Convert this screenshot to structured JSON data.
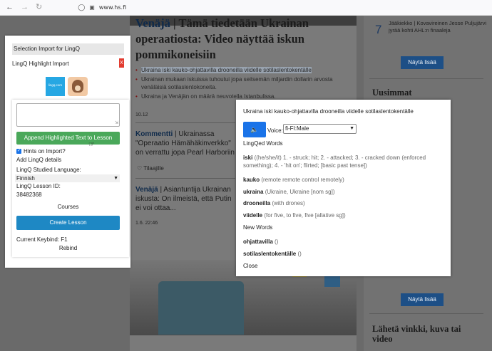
{
  "browser": {
    "url": "www.hs.fi",
    "back_icon": "arrow-left-icon",
    "forward_icon": "arrow-right-icon",
    "reload_icon": "reload-icon"
  },
  "article": {
    "title_kw": "Venäjä",
    "title_rest": " | Tämä tiedetään Ukrainan operaatiosta: Video näyttää iskun pommikoneisiin",
    "bullets": [
      "Ukraina iski kauko-ohjattavilla drooneilla viidelle sotilaslentokentälle",
      "Ukrainan mukaan iskuissa tuhoutui jopa seitsemän miljardin dollarin arvosta venäläisiä sotilaslentokoneita.",
      "Ukraina ja Venäjän on määrä neuvotella Istanbulissa."
    ],
    "time1": "10.12",
    "k1_kw": "Kommentti",
    "k1_rest": " | Ukrainassa \"Operaatio Hämähäkinverkko\" on verrattu jopa Pearl Harboriin",
    "subscribe": "Tilaajille",
    "k2_kw": "Venäjä",
    "k2_rest": " | Asiantuntija Ukrainan iskusta: On ilmeistä, että Putin ei voi ottaa...",
    "time2": "1.6. 22:46"
  },
  "sidebar": {
    "rank": "7",
    "rank_text": "Jääkiekko | Kovavireinen Jesse Puljujärvi jyrää kohti AHL:n finaaleja",
    "show_more": "Näytä lisää",
    "latest": "Uusimmat",
    "tip_head": "Lähetä vinkki, kuva tai video"
  },
  "lingq_panel": {
    "header": "Selection Import for LingQ",
    "title": "LingQ Highlight Import",
    "close_glyph": "X",
    "logo_text": "lingq.com",
    "append_label": "Append Highlighted Text to Lesson",
    "hints_label": "Hints on Import?",
    "add_details": "Add LingQ details",
    "language_label": "LingQ Studied Language:",
    "language_value": "Finnish",
    "lesson_id_label": "LingQ Lesson ID:",
    "lesson_id_value": "38482368",
    "courses": "Courses",
    "create_label": "Create Lesson",
    "keybind": "Current Keybind: F1",
    "rebind": "Rebind"
  },
  "translation_panel": {
    "sentence": "Ukraina iski kauko-ohjattavilla drooneilla viidelle sotilaslentokentälle",
    "voice_label": "Voice:",
    "voice_value": "fi-FI:Male",
    "lingqed_title": "LingQed Words",
    "lingqed": [
      {
        "word": "iski",
        "def": " ((he/she/it) 1. - struck; hit; 2. - attacked; 3. - cracked down (enforced something); 4. - 'hit on'; flirted; [basic past tense])"
      },
      {
        "word": "kauko",
        "def": " (remote remote control remotely)"
      },
      {
        "word": "ukraina",
        "def": " (Ukraine, Ukraine [nom sg])"
      },
      {
        "word": "drooneilla",
        "def": " (with drones)"
      },
      {
        "word": "viidelle",
        "def": " (for five, to five, five [allative sg])"
      }
    ],
    "new_title": "New Words",
    "new_words": [
      {
        "word": "ohjattavilla",
        "def": " ()"
      },
      {
        "word": "sotilaslentokentälle",
        "def": " ()"
      }
    ],
    "close": "Close"
  }
}
